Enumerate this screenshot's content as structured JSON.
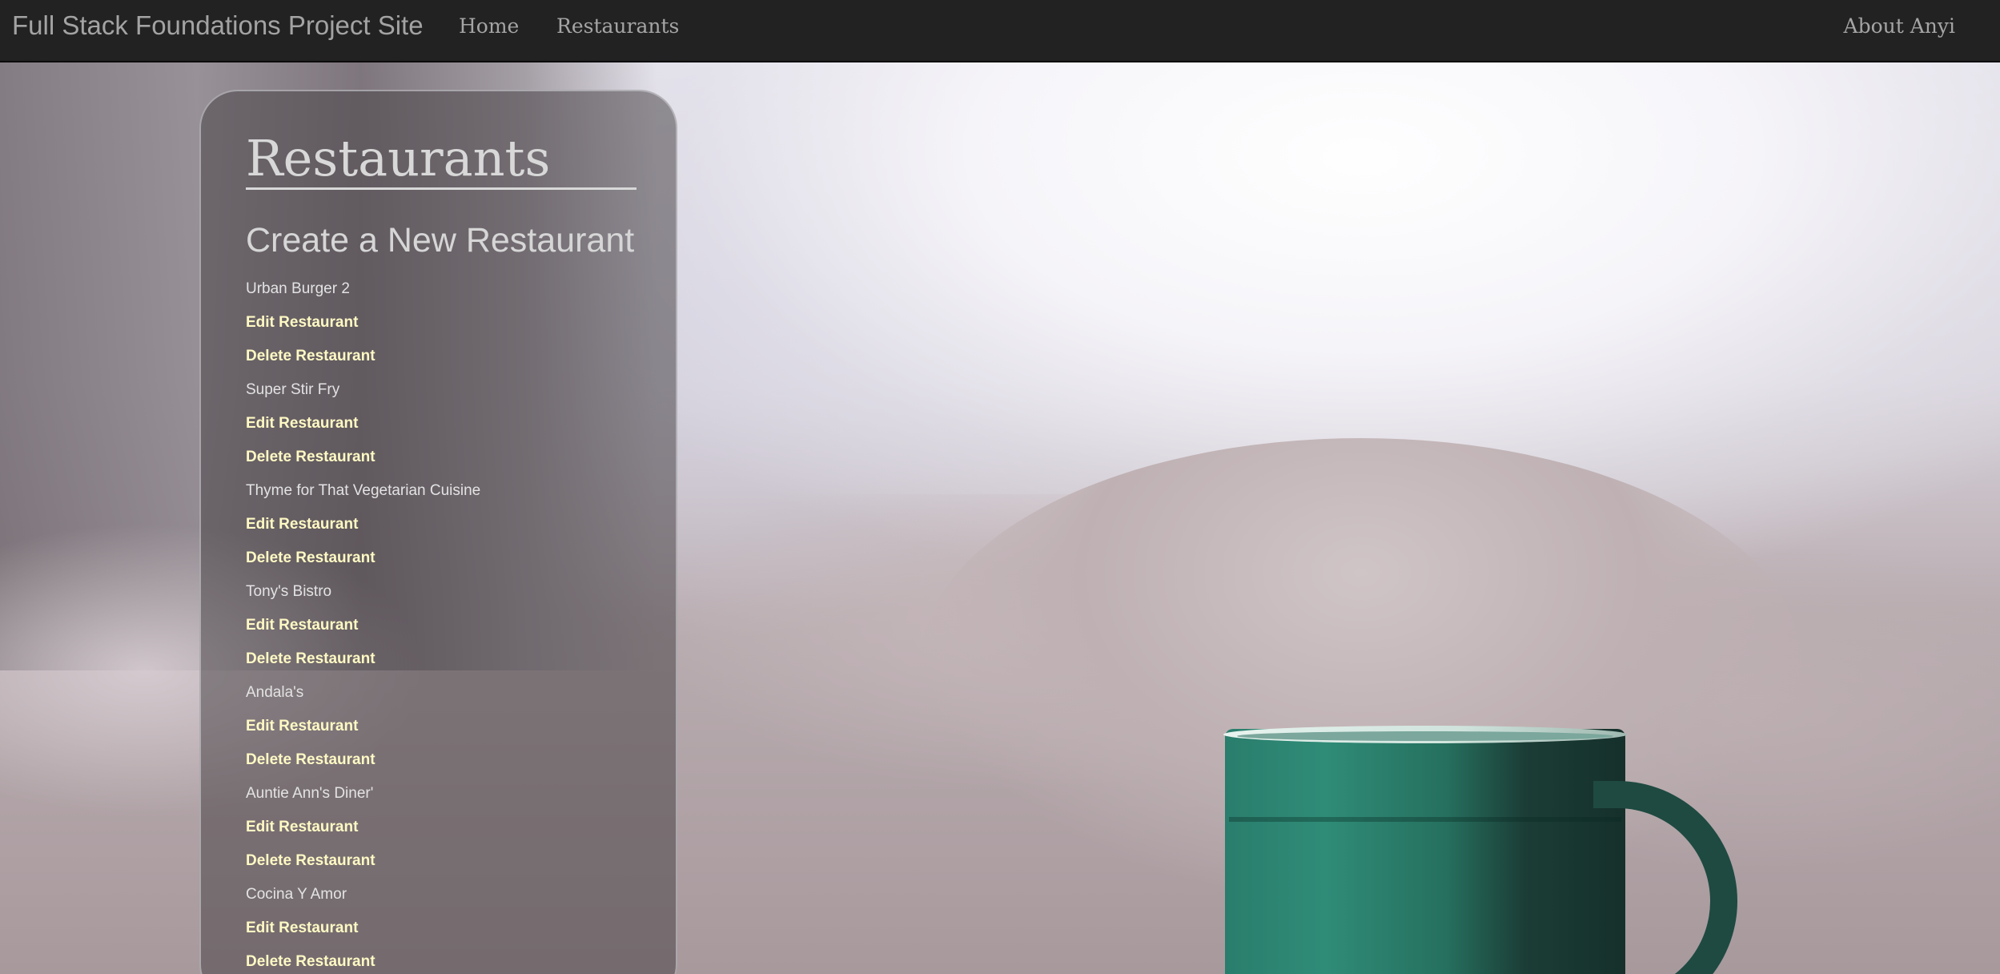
{
  "navbar": {
    "brand": "Full Stack Foundations Project Site",
    "home": "Home",
    "restaurants": "Restaurants",
    "about": "About Anyi"
  },
  "panel": {
    "title": "Restaurants",
    "create_link": "Create a New Restaurant",
    "edit_label": "Edit Restaurant",
    "delete_label": "Delete Restaurant",
    "restaurants": [
      "Urban Burger 2",
      "Super Stir Fry",
      "Thyme for That Vegetarian Cuisine",
      "Tony's Bistro",
      "Andala's",
      "Auntie Ann's Diner'",
      "Cocina Y Amor"
    ]
  },
  "colors": {
    "navbar_bg": "#222222",
    "nav_text": "#a5a5a5",
    "action_link": "#fff9c4",
    "restaurant_name": "#e3e3e3"
  }
}
